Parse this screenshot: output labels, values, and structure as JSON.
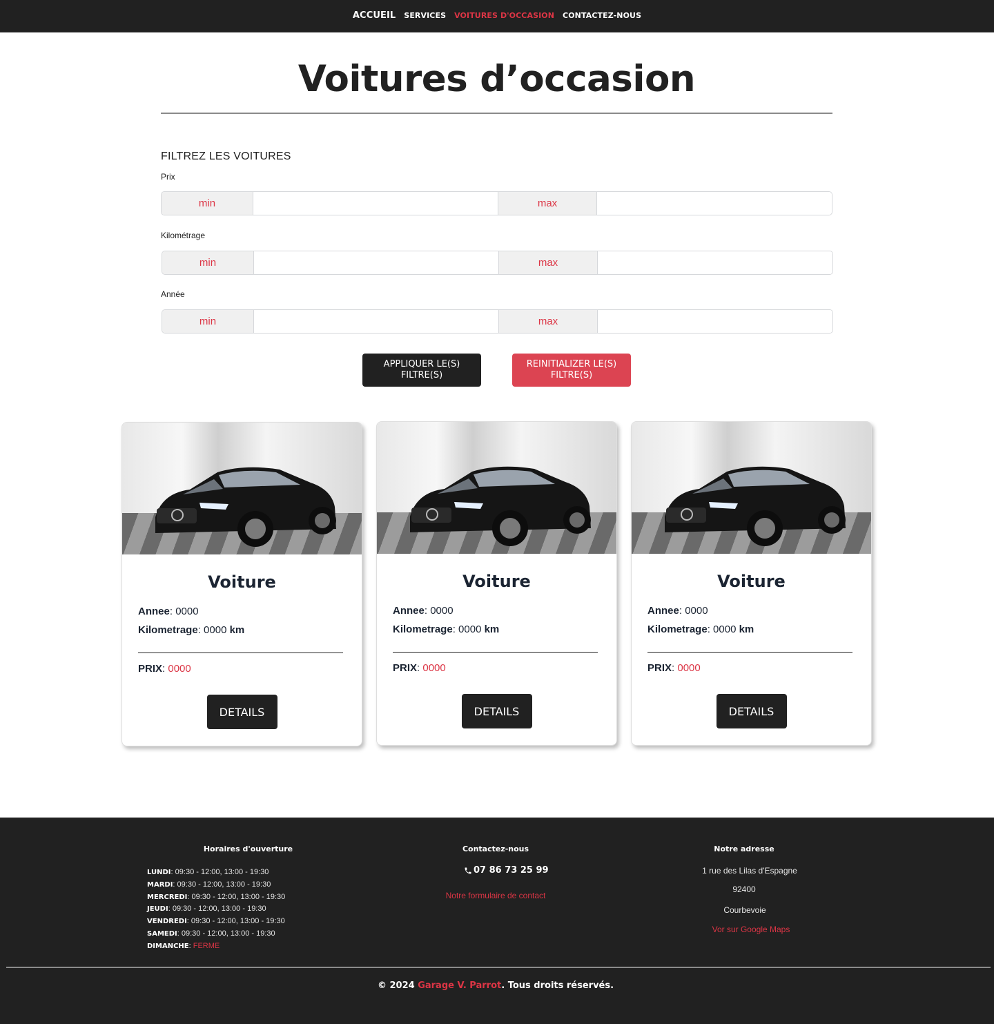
{
  "nav": {
    "items": [
      {
        "label": "ACCUEIL"
      },
      {
        "label": "SERVICES"
      },
      {
        "label": "VOITURES D'OCCASION"
      },
      {
        "label": "CONTACTEZ-NOUS"
      }
    ],
    "active_index": 2
  },
  "page": {
    "title": "Voitures d’occasion"
  },
  "filters": {
    "heading": "FILTREZ LES VOITURES",
    "groups": [
      {
        "label": "Prix",
        "min_label": "min",
        "max_label": "max",
        "min_value": "",
        "max_value": ""
      },
      {
        "label": "Kilométrage",
        "min_label": "min",
        "max_label": "max",
        "min_value": "",
        "max_value": ""
      },
      {
        "label": "Année",
        "min_label": "min",
        "max_label": "max",
        "min_value": "",
        "max_value": ""
      }
    ],
    "apply_label_1": "APPLIQUER LE(S)",
    "apply_label_2": "FILTRE(S)",
    "reset_label_1": "REINITIALIZER LE(S)",
    "reset_label_2": "FILTRE(S)"
  },
  "cars": [
    {
      "title": "Voiture",
      "year_label": "Annee",
      "year": "0000",
      "km_label": "Kilometrage",
      "km": "0000",
      "km_unit": "km",
      "price_label": "PRIX",
      "price": "0000",
      "details_label": "DETAILS",
      "image_icon": "car-photo"
    },
    {
      "title": "Voiture",
      "year_label": "Annee",
      "year": "0000",
      "km_label": "Kilometrage",
      "km": "0000",
      "km_unit": "km",
      "price_label": "PRIX",
      "price": "0000",
      "details_label": "DETAILS",
      "image_icon": "car-photo"
    },
    {
      "title": "Voiture",
      "year_label": "Annee",
      "year": "0000",
      "km_label": "Kilometrage",
      "km": "0000",
      "km_unit": "km",
      "price_label": "PRIX",
      "price": "0000",
      "details_label": "DETAILS",
      "image_icon": "car-photo"
    }
  ],
  "footer": {
    "hours_title": "Horaires d'ouverture",
    "hours": [
      {
        "day": "LUNDI",
        "time": "09:30 - 12:00, 13:00 - 19:30"
      },
      {
        "day": "MARDI",
        "time": "09:30 - 12:00, 13:00 - 19:30"
      },
      {
        "day": "MERCREDI",
        "time": "09:30 - 12:00, 13:00 - 19:30"
      },
      {
        "day": "JEUDI",
        "time": "09:30 - 12:00, 13:00 - 19:30"
      },
      {
        "day": "VENDREDI",
        "time": "09:30 - 12:00, 13:00 - 19:30"
      },
      {
        "day": "SAMEDI",
        "time": "09:30 - 12:00, 13:00 - 19:30"
      },
      {
        "day": "DIMANCHE",
        "time": "FERME"
      }
    ],
    "contact_title": "Contactez-nous",
    "phone": "07 86 73 25 99",
    "phone_icon": "phone-icon",
    "contact_form_link": "Notre formulaire de contact",
    "address_title": "Notre adresse",
    "address_street": "1 rue des Lilas d'Espagne",
    "address_zip": "92400",
    "address_city": "Courbevoie",
    "maps_link": "Vor sur Google Maps",
    "copyright_prefix": "© 2024 ",
    "copyright_brand": "Garage V. Parrot",
    "copyright_suffix": ". Tous droits réservés."
  },
  "colors": {
    "accent": "#dc3545",
    "dark": "#212121",
    "reset_button": "#dc4452"
  }
}
